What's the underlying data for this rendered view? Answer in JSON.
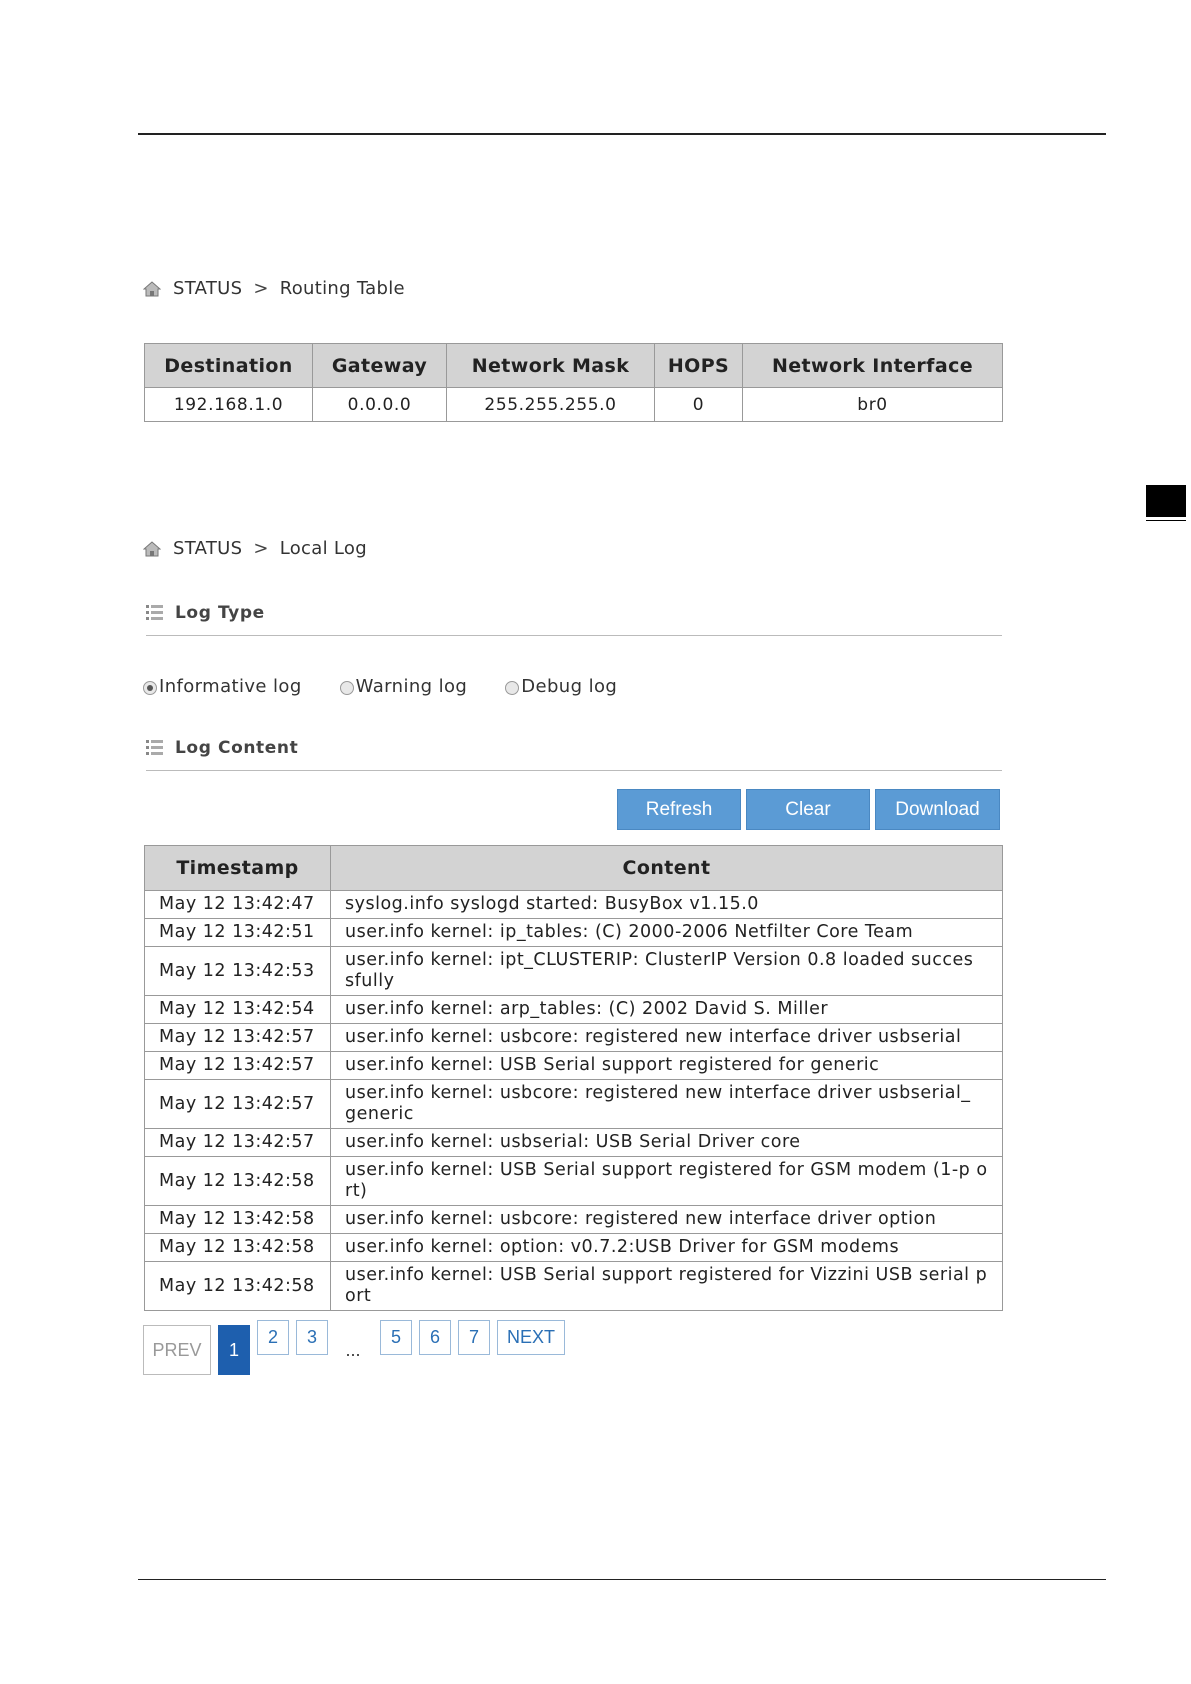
{
  "routing": {
    "breadcrumb": {
      "root": "STATUS",
      "separator": ">",
      "page": "Routing Table"
    },
    "headers": [
      "Destination",
      "Gateway",
      "Network Mask",
      "HOPS",
      "Network Interface"
    ],
    "rows": [
      [
        "192.168.1.0",
        "0.0.0.0",
        "255.255.255.0",
        "0",
        "br0"
      ]
    ]
  },
  "local_log": {
    "breadcrumb": {
      "root": "STATUS",
      "separator": ">",
      "page": "Local Log"
    },
    "log_type_title": "Log Type",
    "log_types": [
      {
        "label": "Informative log",
        "selected": true
      },
      {
        "label": "Warning log",
        "selected": false
      },
      {
        "label": "Debug log",
        "selected": false
      }
    ],
    "log_content_title": "Log Content",
    "buttons": {
      "refresh": "Refresh",
      "clear": "Clear",
      "download": "Download"
    },
    "headers": [
      "Timestamp",
      "Content"
    ],
    "rows": [
      [
        "May 12 13:42:47",
        "syslog.info syslogd started: BusyBox v1.15.0"
      ],
      [
        "May 12 13:42:51",
        "user.info kernel: ip_tables: (C) 2000-2006 Netfilter Core Team"
      ],
      [
        "May 12 13:42:53",
        "user.info kernel: ipt_CLUSTERIP: ClusterIP Version 0.8 loaded succes sfully"
      ],
      [
        "May 12 13:42:54",
        "user.info kernel: arp_tables: (C) 2002 David S. Miller"
      ],
      [
        "May 12 13:42:57",
        "user.info kernel: usbcore: registered new interface driver usbserial"
      ],
      [
        "May 12 13:42:57",
        "user.info kernel: USB Serial support registered for generic"
      ],
      [
        "May 12 13:42:57",
        "user.info kernel: usbcore: registered new interface driver usbserial_ generic"
      ],
      [
        "May 12 13:42:57",
        "user.info kernel: usbserial: USB Serial Driver core"
      ],
      [
        "May 12 13:42:58",
        "user.info kernel: USB Serial support registered for GSM modem (1-p ort)"
      ],
      [
        "May 12 13:42:58",
        "user.info kernel: usbcore: registered new interface driver option"
      ],
      [
        "May 12 13:42:58",
        "user.info kernel: option: v0.7.2:USB Driver for GSM modems"
      ],
      [
        "May 12 13:42:58",
        "user.info kernel: USB Serial support registered for Vizzini USB serial port"
      ]
    ],
    "pagination": {
      "prev": "PREV",
      "pages": [
        "1",
        "2",
        "3"
      ],
      "ellipsis": "...",
      "pages_after": [
        "5",
        "6",
        "7"
      ],
      "next": "NEXT",
      "current": "1"
    }
  },
  "colors": {
    "button": "#5b9bd5",
    "active_page": "#1e5fae",
    "header_bg": "#d3d3d3"
  }
}
